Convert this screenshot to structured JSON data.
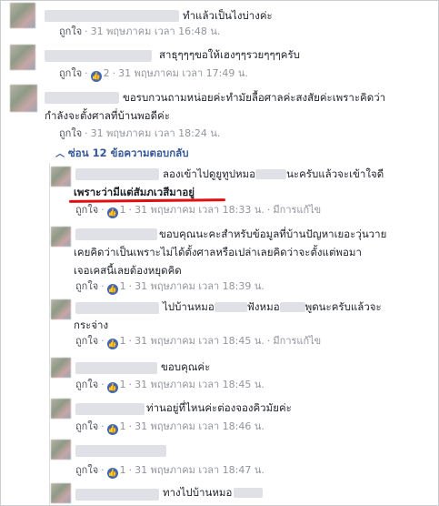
{
  "comments": [
    {
      "text": "ทำแล้วเป็นไงบ่างค่ะ",
      "like": "ถูกใจ",
      "likes": "",
      "time": "31 พฤษภาคม เวลา 16:48 น."
    },
    {
      "text": "สาธุๆๆๆขอให้เฮงๆๆรวยๆๆๆครับ",
      "like": "ถูกใจ",
      "likes": "2",
      "time": "31 พฤษภาคม เวลา 17:49 น."
    },
    {
      "line1": "ขอรบกวนถามหน่อยค่ะทำมัยลื้อศาลค่ะสงสัยค่ะเพราะคิดว่า",
      "line2": "กำลังจะตั้งศาลที่บ้านพอดีค่ะ",
      "like": "ถูกใจ",
      "likes": "",
      "time": "31 พฤษภาคม เวลา 18:24 น."
    }
  ],
  "replies_toggle": "ซ่อน 12 ข้อความตอบกลับ",
  "replies": [
    {
      "line1_a": "ลองเข้าไปดูยูทูปหมอ",
      "line1_b": "นะครับแล้วจะเข้าใจดี",
      "line2": "เพราะว่ามีแต่สัมภเวสีมาอยู่",
      "like": "ถูกใจ",
      "likes": "1",
      "time": "31 พฤษภาคม เวลา 18:33 น.",
      "edited": "มีการแก้ไข"
    },
    {
      "line1": "ขอบคุณนะคะสำหรับข้อมูลที่บ้านปัญหาเยอะวุ่นวาย",
      "line2": "เคยคิดว่าเป็นเพราะไม่ได้ตั้งศาลหรือเปล่าเลยคิดว่าจะตั้งแต่พอมา",
      "line3": "เจอเคสนี้เลยต้องหยุดคิด",
      "like": "ถูกใจ",
      "likes": "1",
      "time": "31 พฤษภาคม เวลา 18:39 น."
    },
    {
      "line1_a": "ไปบ้านหมอ",
      "line1_b": "ฟังหมอ",
      "line1_c": "พูดนะครับแล้วจะ",
      "line2": "กระจ่าง",
      "like": "ถูกใจ",
      "likes": "1",
      "time": "31 พฤษภาคม เวลา 18:45 น.",
      "edited": "มีการแก้ไข"
    },
    {
      "text": "ขอบคุณค่ะ",
      "like": "ถูกใจ",
      "likes": "1",
      "time": "31 พฤษภาคม เวลา 18:45 น."
    },
    {
      "text": "ท่านอยู่ที่ไหนค่ะต่องจองคิวมัยค่ะ",
      "like": "ถูกใจ",
      "likes": "1",
      "time": "31 พฤษภาคม เวลา 18:46 น."
    },
    {
      "text": "",
      "like": "ถูกใจ",
      "likes": "1",
      "time": "31 พฤษภาคม เวลา 18:47 น."
    },
    {
      "text": "ทางไปบ้านหมอ"
    }
  ],
  "colors": {
    "link": "#365899",
    "meta": "#90949c",
    "like_badge": "#4267b2",
    "highlight": "#e01010"
  },
  "icons": {
    "like": "thumbs-up-icon",
    "toggle": "chevron-up-icon"
  }
}
